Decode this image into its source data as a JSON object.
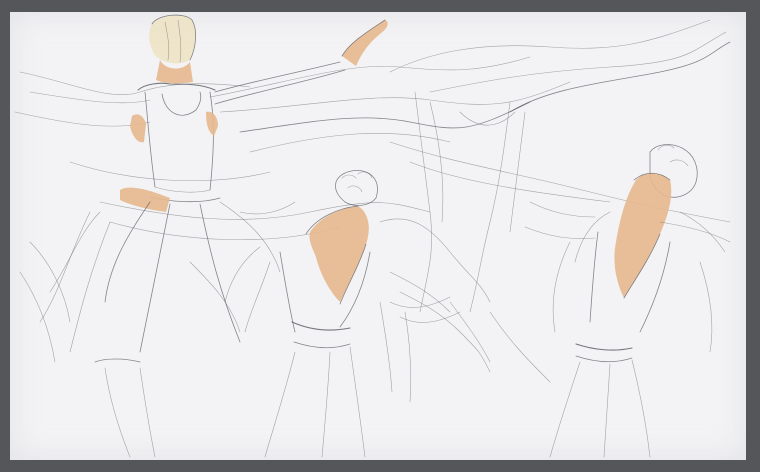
{
  "image": {
    "background_color": "#54565a",
    "paper_color": "#f3f3f5",
    "pencil_color": "#5f6066",
    "skin_tone_color": "#e6b88e",
    "hair_color": "#ede2c2",
    "figures": [
      "left-dancer",
      "center-dancer",
      "right-dancer"
    ]
  }
}
